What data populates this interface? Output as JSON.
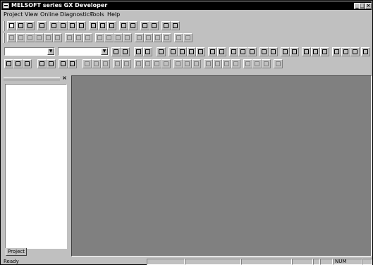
{
  "window": {
    "title": "MELSOFT series GX Developer",
    "controls": {
      "minimize": "_",
      "maximize": "□",
      "close": "×"
    }
  },
  "menu": [
    {
      "label": "Project"
    },
    {
      "label": "View"
    },
    {
      "label": "Online"
    },
    {
      "label": "Diagnostics"
    },
    {
      "label": "Tools"
    },
    {
      "label": "Help"
    }
  ],
  "project_panel": {
    "close": "×",
    "tab_label": "Project"
  },
  "status_bar": {
    "ready": "Ready",
    "num": "NUM"
  },
  "icons": [
    "new-icon",
    "open-icon",
    "save-icon",
    "print-icon",
    "cut-icon",
    "copy-icon",
    "paste-icon",
    "undo-icon",
    "search-icon",
    "ladder-icon",
    "sfc-icon",
    "monitor-icon",
    "write-icon",
    "read-icon",
    "compile-icon",
    "zoom-icon"
  ]
}
